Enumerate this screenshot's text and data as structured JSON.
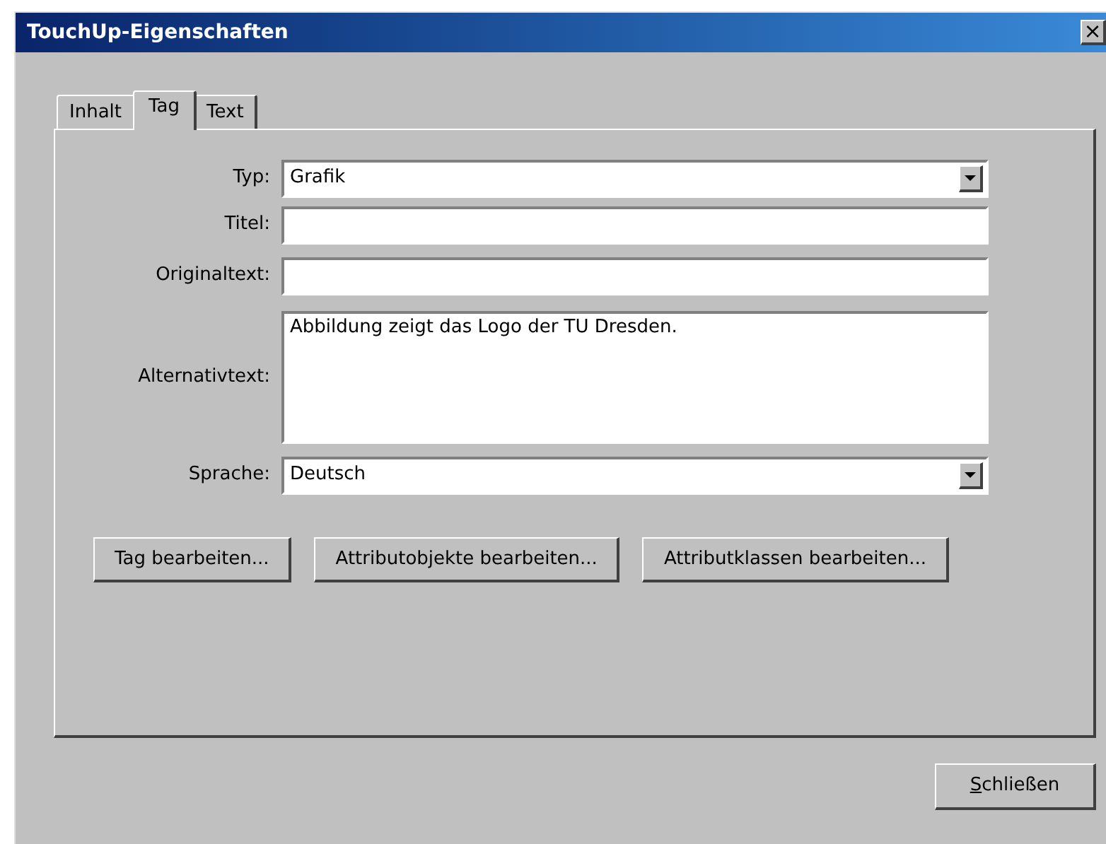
{
  "window": {
    "title": "TouchUp-Eigenschaften",
    "close_glyph": "×"
  },
  "tabs": [
    {
      "label": "Inhalt",
      "selected": false
    },
    {
      "label": "Tag",
      "selected": true
    },
    {
      "label": "Text",
      "selected": false
    }
  ],
  "fields": [
    {
      "label": "Typ:",
      "kind": "dropdown",
      "value": "Grafik"
    },
    {
      "label": "Titel:",
      "kind": "text"
    },
    {
      "label": "Originaltext:",
      "kind": "text"
    },
    {
      "label": "Alternativtext:",
      "kind": "textarea",
      "value": "Abbildung zeigt das Logo der TU Dresden."
    },
    {
      "label": "Sprache:",
      "kind": "dropdown",
      "value": "Deutsch"
    }
  ],
  "buttons": [
    "Tag bearbeiten...",
    "Attributobjekte bearbeiten...",
    "Attributklassen bearbeiten..."
  ],
  "close_button": {
    "access_key": "S",
    "label_rest": "chließen"
  }
}
